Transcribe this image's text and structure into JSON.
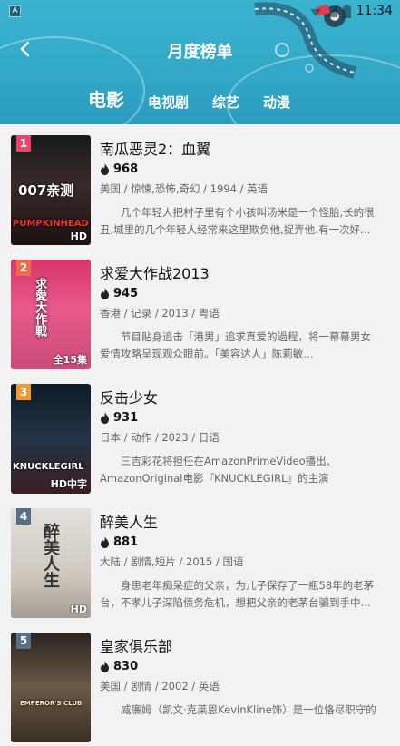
{
  "status_bar": {
    "app_icon": "A",
    "time": "11:34"
  },
  "header": {
    "title": "月度榜单",
    "back_icon": "chevron-left-icon"
  },
  "tabs": [
    {
      "label": "电影",
      "active": true
    },
    {
      "label": "电视剧",
      "active": false
    },
    {
      "label": "综艺",
      "active": false
    },
    {
      "label": "动漫",
      "active": false
    }
  ],
  "items": [
    {
      "rank": "1",
      "rank_color": "#e8456b",
      "title": "南瓜恶灵2：血翼",
      "heat": "968",
      "meta": "美国 / 惊悚,恐怖,奇幻 / 1994 / 英语",
      "desc": "几个年轻人把村子里有个小孩叫汤米是一个怪胎,长的很丑,城里的几个年轻人经常来这里欺负他,捉弄他.有一次好…",
      "poster_tag": "HD",
      "poster_text": "007亲测",
      "poster_logo": "PUMPKINHEAD",
      "poster_bg": "linear-gradient(180deg,#1a1a1a 0%,#3a2a2a 45%,#1b1212 100%)"
    },
    {
      "rank": "2",
      "rank_color": "#f06a4a",
      "title": "求爱大作战2013",
      "heat": "945",
      "meta": "香港 / 记录 / 2013 / 粤语",
      "desc": "节目贴身追击「港男」追求真爱的過程，将一幕幕男女爱情攻略呈现观众眼前。「美容达人」陈莉敏…",
      "poster_tag": "全15集",
      "poster_text": "求愛大作戰",
      "poster_logo": "",
      "poster_bg": "linear-gradient(180deg,#d9356c 0%,#e85a8c 45%,#c94a78 100%)"
    },
    {
      "rank": "3",
      "rank_color": "#f29a2e",
      "title": "反击少女",
      "heat": "931",
      "meta": "日本 / 动作 / 2023 / 日语",
      "desc": "三吉彩花将担任在AmazonPrimeVideo播出、AmazonOriginal电影『KNUCKLEGIRL』的主演",
      "poster_tag": "HD中字",
      "poster_text": "",
      "poster_logo": "KNUCKLEGIRL",
      "poster_bg": "linear-gradient(180deg,#0f1a26 0%,#233447 50%,#3b1e22 100%)"
    },
    {
      "rank": "4",
      "rank_color": "#5a6e88",
      "title": "醉美人生",
      "heat": "881",
      "meta": "大陆 / 剧情,短片 / 2015 / 国语",
      "desc": "身患老年痴呆症的父亲，为儿子保存了一瓶58年的老茅台，不孝儿子深陷债务危机，想把父亲的老茅台骗到手中…",
      "poster_tag": "HD",
      "poster_text": "醉美人生",
      "poster_logo": "",
      "poster_bg": "linear-gradient(180deg,#e3e0db 0%,#cfc9c0 60%,#a49c92 100%)"
    },
    {
      "rank": "5",
      "rank_color": "#5a6e88",
      "title": "皇家俱乐部",
      "heat": "830",
      "meta": "美国 / 剧情 / 2002 / 英语",
      "desc": "威廉姆（凯文·克莱恩KevinKline饰）是一位恪尽职守的",
      "poster_tag": "",
      "poster_text": "",
      "poster_logo": "EMPEROR'S CLUB",
      "poster_bg": "linear-gradient(180deg,#2a2420 0%,#6b5a47 50%,#3a2e24 100%)"
    }
  ]
}
